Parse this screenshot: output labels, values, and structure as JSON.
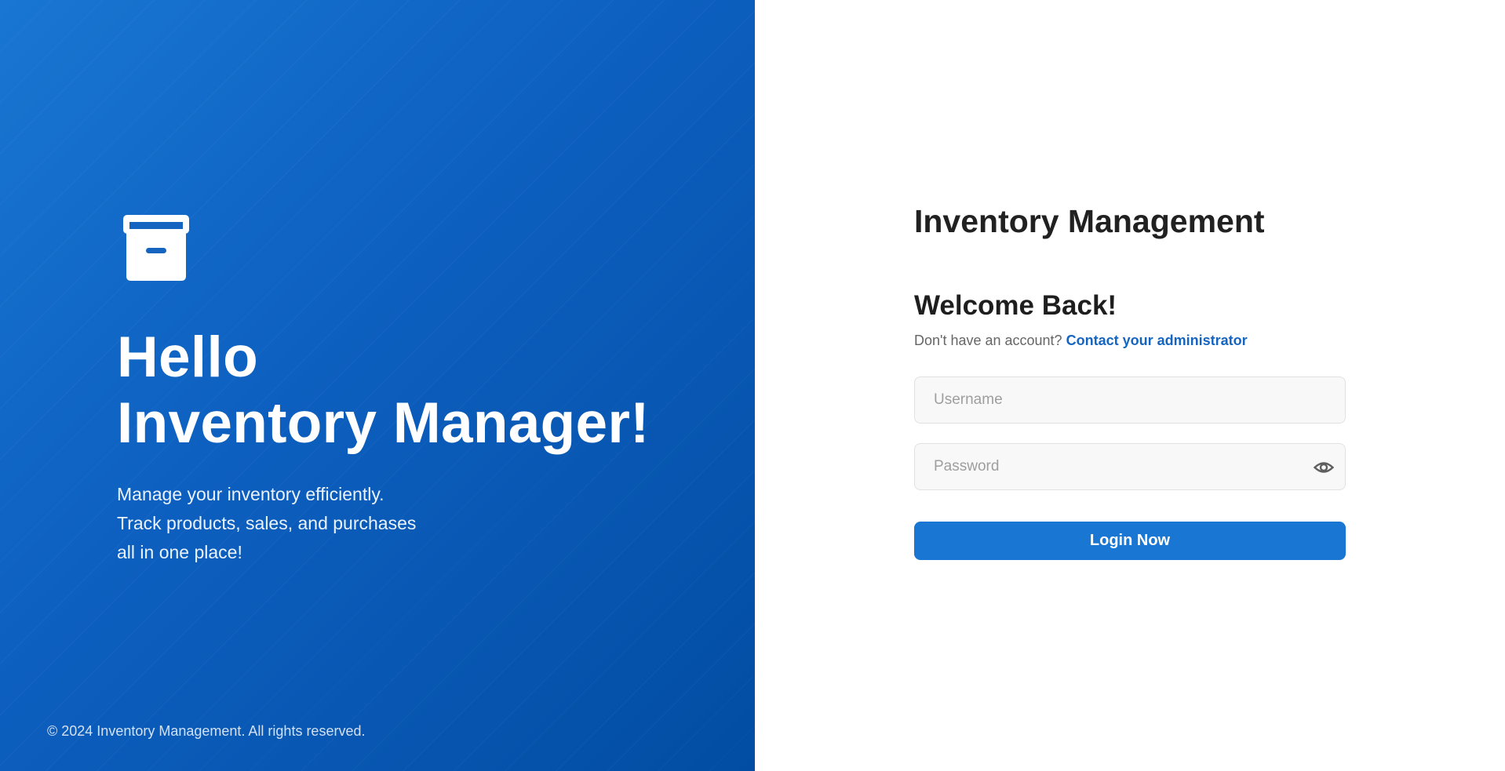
{
  "hero": {
    "icon": "archive-box-icon",
    "title_line1": "Hello",
    "title_line2": "Inventory Manager!",
    "desc_line1": "Manage your inventory efficiently.",
    "desc_line2": "Track products, sales, and purchases",
    "desc_line3": "all in one place!",
    "footer": "© 2024 Inventory Management. All rights reserved."
  },
  "login": {
    "app_title": "Inventory Management",
    "welcome": "Welcome Back!",
    "no_account_text": "Don't have an account?",
    "contact_link": "Contact your administrator",
    "username_placeholder": "Username",
    "username_value": "",
    "password_placeholder": "Password",
    "password_value": "",
    "password_toggle_icon": "eye-icon",
    "submit_label": "Login Now"
  },
  "colors": {
    "primary": "#1976d2",
    "hero_gradient_start": "#1976d2",
    "hero_gradient_end": "#024da3",
    "link": "#1565c0",
    "input_bg": "#f8f8f8",
    "heading_text": "#212121"
  }
}
